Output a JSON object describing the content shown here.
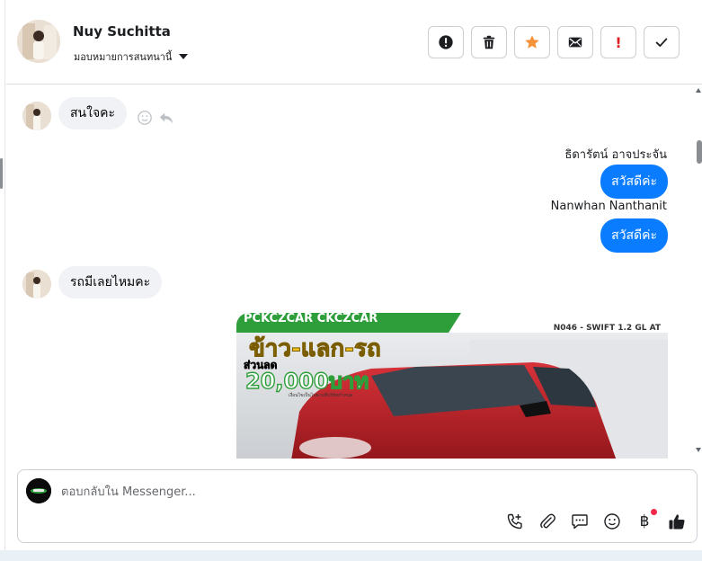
{
  "header": {
    "contact_name": "Nuy Suchitta",
    "assign_label": "มอบหมายการสนทนานี้",
    "actions": [
      {
        "name": "mark-spam-button",
        "icon": "exclamation-circle-icon"
      },
      {
        "name": "delete-button",
        "icon": "trash-icon"
      },
      {
        "name": "star-button",
        "icon": "star-icon",
        "color": "#f7923a"
      },
      {
        "name": "mark-unread-button",
        "icon": "envelope-icon"
      },
      {
        "name": "follow-up-button",
        "icon": "exclamation-icon",
        "color": "#e02020"
      },
      {
        "name": "mark-done-button",
        "icon": "check-icon"
      }
    ],
    "follow_up_glyph": "!"
  },
  "thread": {
    "messages": [
      {
        "direction": "in",
        "text": "สนใจคะ"
      },
      {
        "direction": "out",
        "sender": "ธิดารัตน์ อาจประจัน",
        "text": "สวัสดีค่ะ"
      },
      {
        "direction": "out",
        "sender": "Nanwhan Nanthanit",
        "text": "สวัสดีค่ะ"
      },
      {
        "direction": "in",
        "text": "รถมีเลยไหมคะ"
      },
      {
        "direction": "out",
        "type": "image"
      }
    ],
    "image": {
      "banner_top": "PCKCZCAR CKCZCAR",
      "model_tag": "N046 - SWIFT 1.2 GL AT",
      "headline": "ข้าว-แลก-รถ",
      "discount_label": "ส่วนลด",
      "discount_value": "20,000บาท",
      "fine_print": "เงื่อนไขเป็นไปตามที่บริษัทกำหนด",
      "colors": {
        "car": "#c9252d",
        "headline": "#f2c21b",
        "banner": "#2e9e3a"
      }
    }
  },
  "composer": {
    "placeholder": "ตอบกลับใน Messenger...",
    "tools": [
      "call-icon",
      "paperclip-icon",
      "saved-replies-icon",
      "emoji-icon",
      "baht-icon",
      "thumbs-up-icon"
    ],
    "baht_symbol": "฿"
  },
  "colors": {
    "accent": "#0a7cff",
    "incoming": "#f0f2f5",
    "notification": "#f02849"
  }
}
